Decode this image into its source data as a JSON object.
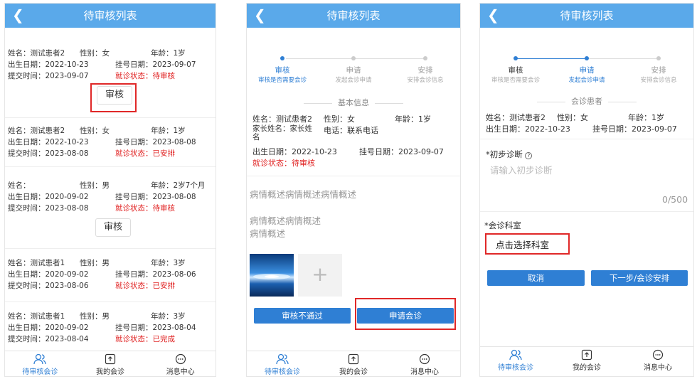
{
  "screen1": {
    "title": "待审核列表",
    "cards": [
      {
        "name": "姓名：测试患者2",
        "gender": "性别：女",
        "age": "年龄：1岁",
        "birth": "出生日期：2022-10-23",
        "reg": "挂号日期：2023-09-07",
        "submit": "提交时间：2023-09-07",
        "status_label": "就诊状态：",
        "status": "待审核",
        "button": "审核"
      },
      {
        "name": "姓名：测试患者2",
        "gender": "性别：女",
        "age": "年龄：1岁",
        "birth": "出生日期：2022-10-23",
        "reg": "挂号日期：2023-08-08",
        "submit": "提交时间：2023-08-08",
        "status_label": "就诊状态：",
        "status": "已安排"
      },
      {
        "name": "姓名：",
        "gender": "性别：男",
        "age": "年龄：2岁7个月",
        "birth": "出生日期：2020-09-02",
        "reg": "挂号日期：2023-08-08",
        "submit": "提交时间：2023-08-08",
        "status_label": "就诊状态：",
        "status": "待审核",
        "button": "审核"
      },
      {
        "name": "姓名：测试患者1",
        "gender": "性别：男",
        "age": "年龄：3岁",
        "birth": "出生日期：2020-09-02",
        "reg": "挂号日期：2023-08-06",
        "submit": "提交时间：2023-08-06",
        "status_label": "就诊状态：",
        "status": "已安排"
      },
      {
        "name": "姓名：测试患者1",
        "gender": "性别：男",
        "age": "年龄：3岁",
        "birth": "出生日期：2020-09-02",
        "reg": "挂号日期：2023-08-04",
        "submit": "提交时间：2023-08-04",
        "status_label": "就诊状态：",
        "status": "已完成"
      }
    ]
  },
  "screen2": {
    "title": "待审核列表",
    "steps": [
      {
        "title": "审核",
        "sub": "审核是否需要会诊"
      },
      {
        "title": "申请",
        "sub": "发起会诊申请"
      },
      {
        "title": "安排",
        "sub": "安排会诊信息"
      }
    ],
    "section": "基本信息",
    "name": "姓名：测试患者2",
    "gender": "性别：女",
    "age": "年龄：1岁",
    "parent": "家长姓名：家长姓名",
    "phone": "电话：联系电话",
    "birth": "出生日期：2022-10-23",
    "reg": "挂号日期：2023-09-07",
    "status": "就诊状态：待审核",
    "desc1": "病情概述病情概述病情概述",
    "desc2": "病情概述病情概述",
    "desc3": "病情概述",
    "reject_btn": "审核不通过",
    "apply_btn": "申请会诊"
  },
  "screen3": {
    "title": "待审核列表",
    "steps": [
      {
        "title": "审核",
        "sub": "审核是否需要会诊"
      },
      {
        "title": "申请",
        "sub": "发起会诊申请"
      },
      {
        "title": "安排",
        "sub": "安排会诊信息"
      }
    ],
    "section": "会诊患者",
    "name": "姓名：测试患者2",
    "gender": "性别：女",
    "age": "年龄：1岁",
    "birth": "出生日期：2022-10-23",
    "reg": "挂号日期：2023-09-07",
    "diag_label": "*初步诊断",
    "diag_placeholder": "请输入初步诊断",
    "counter": "0/500",
    "dept_label": "*会诊科室",
    "dept_select": "点击选择科室",
    "cancel_btn": "取消",
    "next_btn": "下一步/会诊安排"
  },
  "tabs": [
    "待审核会诊",
    "我的会诊",
    "消息中心"
  ],
  "colors": {
    "header": "#5aa9ea",
    "primary": "#2f7fd4",
    "status_red": "#e02020",
    "highlight_box": "#e02828"
  }
}
